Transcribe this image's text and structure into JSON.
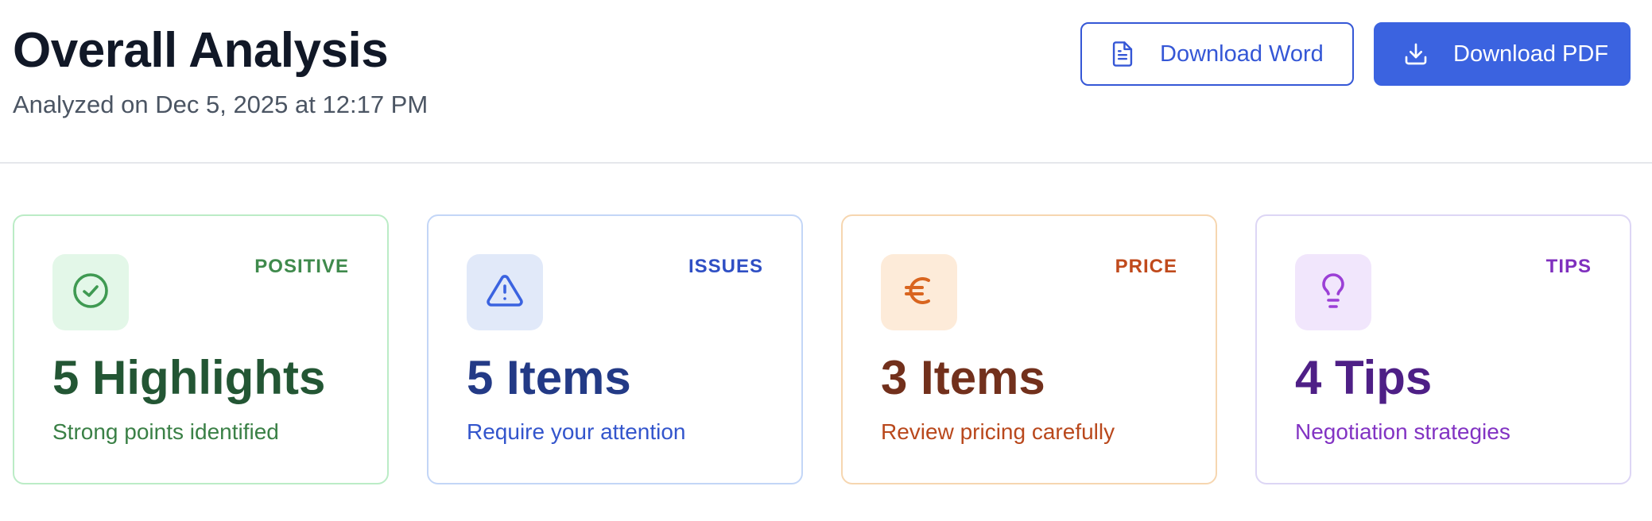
{
  "header": {
    "title": "Overall Analysis",
    "subtitle": "Analyzed on Dec 5, 2025 at 12:17 PM"
  },
  "actions": {
    "download_word": {
      "label": "Download Word",
      "icon": "document-icon"
    },
    "download_pdf": {
      "label": "Download PDF",
      "icon": "download-icon"
    }
  },
  "cards": [
    {
      "tag": "POSITIVE",
      "headline": "5 Highlights",
      "description": "Strong points identified",
      "icon": "check-circle-icon",
      "colors": {
        "border": "#bbecc6",
        "icon_bg": "#e3f7e8",
        "icon": "#3f9a52",
        "tag": "#3f8a4c",
        "headline": "#235634",
        "desc": "#3a8046"
      }
    },
    {
      "tag": "ISSUES",
      "headline": "5 Items",
      "description": "Require your attention",
      "icon": "warning-triangle-icon",
      "colors": {
        "border": "#c3d6f7",
        "icon_bg": "#e1e9f9",
        "icon": "#3b63e0",
        "tag": "#2f4fc4",
        "headline": "#233a86",
        "desc": "#3355cc"
      }
    },
    {
      "tag": "PRICE",
      "headline": "3 Items",
      "description": "Review pricing carefully",
      "icon": "euro-icon",
      "colors": {
        "border": "#f6d6b0",
        "icon_bg": "#fdebd9",
        "icon": "#d9651f",
        "tag": "#c04a1c",
        "headline": "#72301c",
        "desc": "#b9481c"
      }
    },
    {
      "tag": "TIPS",
      "headline": "4 Tips",
      "description": "Negotiation strategies",
      "icon": "lightbulb-icon",
      "colors": {
        "border": "#ddd6f5",
        "icon_bg": "#f1e6fc",
        "icon": "#9b3fd6",
        "tag": "#7f2fbe",
        "headline": "#4e1f86",
        "desc": "#8233c3"
      }
    }
  ]
}
